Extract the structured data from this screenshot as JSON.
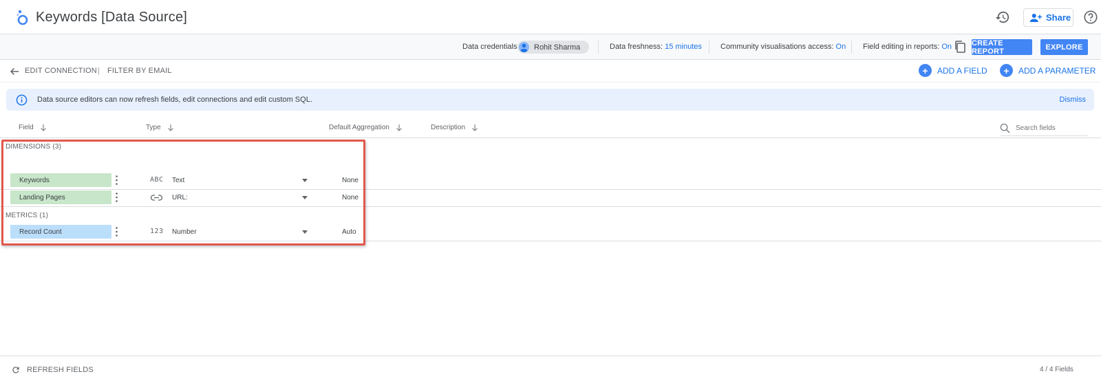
{
  "header": {
    "title": "Keywords [Data Source]",
    "share_label": "Share"
  },
  "infobar": {
    "credentials_label": "Data credentials:",
    "credentials_user": "Rohit Sharma",
    "freshness_label": "Data freshness:",
    "freshness_value": "15 minutes",
    "community_label": "Community visualisations access:",
    "community_value": "On",
    "field_editing_label": "Field editing in reports:",
    "field_editing_value": "On",
    "create_report_label": "CREATE REPORT",
    "explore_label": "EXPLORE"
  },
  "toolbar": {
    "edit_connection": "EDIT CONNECTION",
    "separator": "|",
    "filter_by_email": "FILTER BY EMAIL",
    "add_field": "ADD A FIELD",
    "add_parameter": "ADD A PARAMETER"
  },
  "banner": {
    "text": "Data source editors can now refresh fields, edit connections and edit custom SQL.",
    "dismiss": "Dismiss"
  },
  "columns": {
    "field": "Field",
    "type": "Type",
    "aggregation": "Default Aggregation",
    "description": "Description",
    "search_placeholder": "Search fields"
  },
  "dimensions": {
    "label": "DIMENSIONS (3)",
    "rows": [
      {
        "name": "Keywords",
        "type_icon": "ABC",
        "type": "Text",
        "aggregation": "None"
      },
      {
        "name": "Landing Pages",
        "type_icon": "link-icon",
        "type": "URL:",
        "aggregation": "None"
      }
    ]
  },
  "metrics": {
    "label": "METRICS (1)",
    "rows": [
      {
        "name": "Record Count",
        "type_icon": "123",
        "type": "Number",
        "aggregation": "Auto"
      }
    ]
  },
  "footer": {
    "refresh": "REFRESH FIELDS",
    "field_count": "4 / 4 Fields"
  },
  "colors": {
    "accent": "#4285f4",
    "link": "#1a73e8",
    "dimension": "#c8e6c9",
    "metric": "#bbdefb",
    "highlight": "#e2574c"
  }
}
